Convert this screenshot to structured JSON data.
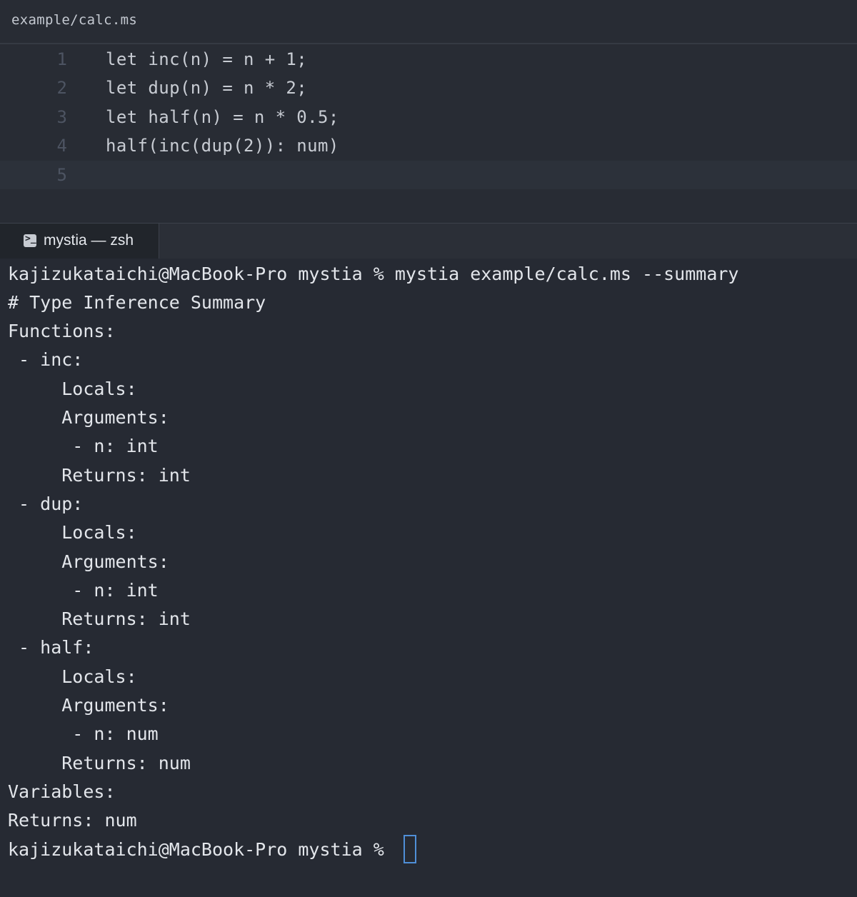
{
  "editor": {
    "file_path": "example/calc.ms",
    "lines": [
      {
        "no": "1",
        "text": "let inc(n) = n + 1;"
      },
      {
        "no": "2",
        "text": "let dup(n) = n * 2;"
      },
      {
        "no": "3",
        "text": "let half(n) = n * 0.5;"
      },
      {
        "no": "4",
        "text": "half(inc(dup(2)): num)"
      },
      {
        "no": "5",
        "text": ""
      }
    ]
  },
  "terminal": {
    "tab_title": "mystia — zsh",
    "tab_icon": "terminal-icon",
    "lines": [
      "kajizukataichi@MacBook-Pro mystia % mystia example/calc.ms --summary",
      "# Type Inference Summary",
      "Functions:",
      " - inc:",
      "     Locals:",
      "     Arguments:",
      "      - n: int",
      "     Returns: int",
      " - dup:",
      "     Locals:",
      "     Arguments:",
      "      - n: int",
      "     Returns: int",
      " - half:",
      "     Locals:",
      "     Arguments:",
      "      - n: num",
      "     Returns: num",
      "Variables:",
      "Returns: num"
    ],
    "prompt": "kajizukataichi@MacBook-Pro mystia % "
  },
  "colors": {
    "background": "#282c34",
    "terminal_background": "#262a33",
    "cursor": "#4f8fd8"
  }
}
